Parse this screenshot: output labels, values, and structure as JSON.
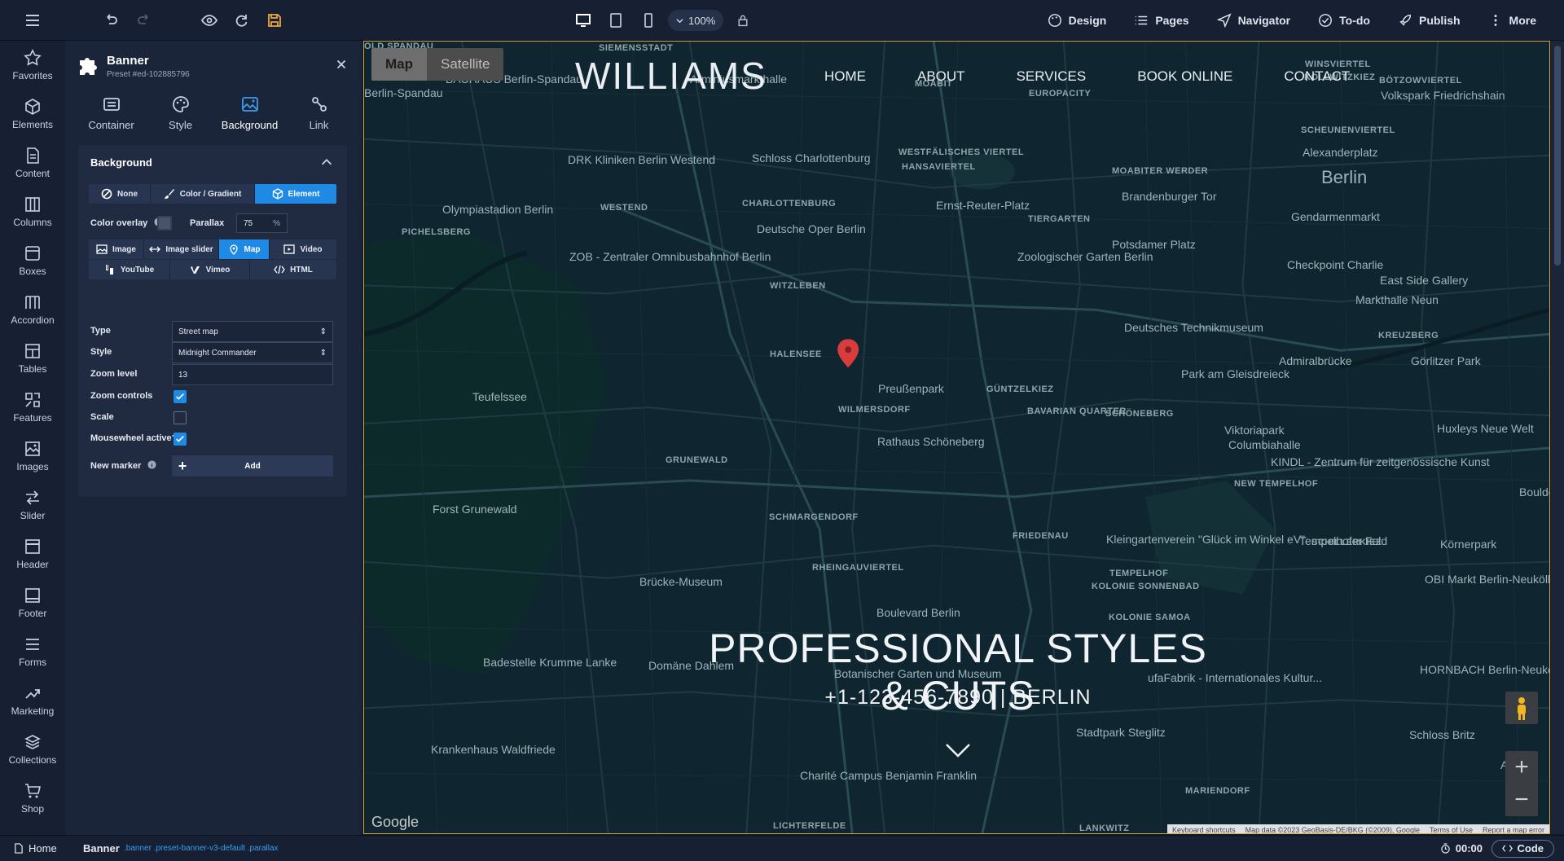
{
  "topbar": {
    "zoom": "100%",
    "menu": [
      "Design",
      "Pages",
      "Navigator",
      "To-do",
      "Publish",
      "More"
    ]
  },
  "rail": [
    "Favorites",
    "Elements",
    "Content",
    "Columns",
    "Boxes",
    "Accordion",
    "Tables",
    "Features",
    "Images",
    "Slider",
    "Header",
    "Footer",
    "Forms",
    "Marketing",
    "Collections",
    "Shop"
  ],
  "panel": {
    "title": "Banner",
    "subtitle": "Preset #ed-102885796",
    "tabs": [
      "Container",
      "Style",
      "Background",
      "Link"
    ],
    "section_title": "Background",
    "bg_modes": [
      "None",
      "Color / Gradient",
      "Element"
    ],
    "color_overlay_label": "Color overlay",
    "parallax_label": "Parallax",
    "parallax_value": "75",
    "parallax_unit": "%",
    "element_types_row1": [
      "Image",
      "Image slider",
      "Map",
      "Video"
    ],
    "element_types_row2": [
      "YouTube",
      "Vimeo",
      "HTML"
    ],
    "type_label": "Type",
    "type_value": "Street map",
    "style_label": "Style",
    "style_value": "Midnight Commander",
    "zoom_label": "Zoom level",
    "zoom_value": "13",
    "zoom_controls_label": "Zoom controls",
    "zoom_controls": true,
    "scale_label": "Scale",
    "scale": false,
    "mousewheel_label": "Mousewheel active?",
    "mousewheel": true,
    "marker_label": "New marker",
    "add_label": "Add"
  },
  "site": {
    "map_btn": "Map",
    "satellite_btn": "Satellite",
    "logo": "WILLIAMS",
    "nav": [
      "HOME",
      "ABOUT",
      "SERVICES",
      "BOOK ONLINE",
      "CONTACT"
    ],
    "hero_title": "PROFESSIONAL STYLES & CUTS",
    "hero_sub": "+1-123-456-7890 | BERLIN",
    "google": "Google",
    "attribution": [
      "Keyboard shortcuts",
      "Map data ©2023 GeoBasis-DE/BKG (©2009), Google",
      "Terms of Use",
      "Report a map error"
    ]
  },
  "map_labels": {
    "places": [
      "OLD SPANDAU",
      "SIEMENSSTADT",
      "BAUHAUS Berlin-Spandau",
      "Berlin-Spandau",
      "Arminiusmarkthalle",
      "MOABIT",
      "EUROPACITY",
      "WINSVIERTEL",
      "KOLLWITZKIEZ",
      "BÖTZOWVIERTEL",
      "Volkspark Friedrichshain",
      "SCHEUNENVIERTEL",
      "Alexanderplatz",
      "Berlin",
      "DRK Kliniken Berlin Westend",
      "Schloss Charlottenburg",
      "WESTFÄLISCHES VIERTEL",
      "HANSAVIERTEL",
      "MOABITER WERDER",
      "Brandenburger Tor",
      "Gendarmenmarkt",
      "Olympiastadion Berlin",
      "WESTEND",
      "CHARLOTTENBURG",
      "Ernst-Reuter-Platz",
      "TIERGARTEN",
      "PICHELSBERG",
      "Deutsche Oper Berlin",
      "Potsdamer Platz",
      "Checkpoint Charlie",
      "ZOB - Zentraler Omnibusbahnhof Berlin",
      "Zoologischer Garten Berlin",
      "East Side Gallery",
      "WITZLEBEN",
      "Markthalle Neun",
      "Deutsches Technikmuseum",
      "KREUZBERG",
      "Admiralbrücke",
      "Görlitzer Park",
      "HALENSEE",
      "Park am Gleisdreieck",
      "Preußenpark",
      "GÜNTZELKIEZ",
      "Teufelssee",
      "WILMERSDORF",
      "BAVARIAN QUARTER",
      "SCHÖNEBERG",
      "Viktoriapark",
      "Columbiahalle",
      "Huxleys Neue Welt",
      "Rathaus Schöneberg",
      "GRUNEWALD",
      "KINDL - Zentrum für zeitgenössische Kunst",
      "NEW TEMPELHOF",
      "Forst Grunewald",
      "SCHMARGENDORF",
      "FRIEDENAU",
      "Kleingartenverein \"Glück im Winkel eV\"",
      "Tempelhofer Feld",
      "SCHILLERKIEZ",
      "Körnerpark",
      "RHEINGAUVIERTEL",
      "TEMPELHOF",
      "Brücke-Museum",
      "KOLONIE SONNENBAD",
      "OBI Markt Berlin-Neukölln",
      "Boulevard Berlin",
      "KOLONIE SAMOA",
      "Badestelle Krumme Lanke",
      "Domäne Dahlem",
      "Botanischer Garten und Museum",
      "ufaFabrik - Internationales Kultur...",
      "HORNBACH Berlin-Neukölln",
      "Stadtpark Steglitz",
      "Schloss Britz",
      "Krankenhaus Waldfriede",
      "Charité Campus Benjamin Franklin",
      "MARIENDORF",
      "LICHTERFELDE",
      "LANKWITZ",
      "Bouldergarten",
      "Actio"
    ]
  },
  "status": {
    "home": "Home",
    "crumb": "Banner",
    "classes": ".banner .preset-banner-v3-default .parallax",
    "time": "00:00",
    "code": "Code"
  }
}
